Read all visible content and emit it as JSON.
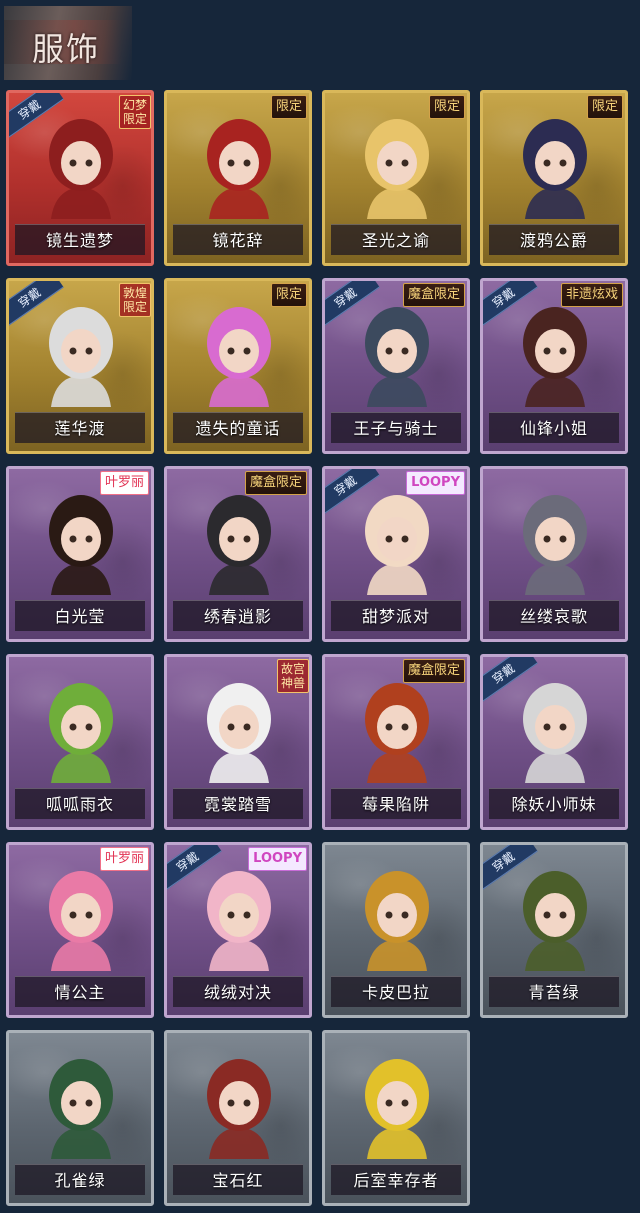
{
  "header": {
    "title": "服饰"
  },
  "badge_wear_label": "穿戴",
  "costumes": [
    {
      "name": "镜生遗梦",
      "rarity": "red",
      "worn": true,
      "tag": "幻梦限定",
      "tag_style": "vertical",
      "accent": "#8d1e1e"
    },
    {
      "name": "镜花辞",
      "rarity": "gold",
      "worn": false,
      "tag": "限定",
      "tag_style": "gold",
      "accent": "#a82320"
    },
    {
      "name": "圣光之谕",
      "rarity": "gold",
      "worn": false,
      "tag": "限定",
      "tag_style": "gold",
      "accent": "#e8c46a"
    },
    {
      "name": "渡鸦公爵",
      "rarity": "gold",
      "worn": false,
      "tag": "限定",
      "tag_style": "gold",
      "accent": "#2c2c52"
    },
    {
      "name": "莲华渡",
      "rarity": "gold",
      "worn": true,
      "tag": "敦煌限定",
      "tag_style": "vertical",
      "accent": "#dcdcdc"
    },
    {
      "name": "遗失的童话",
      "rarity": "gold",
      "worn": false,
      "tag": "限定",
      "tag_style": "gold",
      "accent": "#d86bd0"
    },
    {
      "name": "王子与骑士",
      "rarity": "purple",
      "worn": true,
      "tag": "魔盒限定",
      "tag_style": "gold",
      "accent": "#3c4a5e"
    },
    {
      "name": "仙锋小姐",
      "rarity": "purple",
      "worn": true,
      "tag": "非遗炫戏",
      "tag_style": "gold",
      "accent": "#4a2420"
    },
    {
      "name": "白光莹",
      "rarity": "purple",
      "worn": false,
      "tag": "叶罗丽",
      "tag_style": "pink",
      "accent": "#2a1a14"
    },
    {
      "name": "绣春逍影",
      "rarity": "purple",
      "worn": false,
      "tag": "魔盒限定",
      "tag_style": "gold",
      "accent": "#2b2a2e"
    },
    {
      "name": "甜梦派对",
      "rarity": "purple",
      "worn": true,
      "tag": "LOOPY",
      "tag_style": "loopy",
      "accent": "#f2d9c4"
    },
    {
      "name": "丝缕哀歌",
      "rarity": "purple",
      "worn": false,
      "tag": "",
      "tag_style": "",
      "accent": "#6b6b7a"
    },
    {
      "name": "呱呱雨衣",
      "rarity": "purple",
      "worn": false,
      "tag": "",
      "tag_style": "",
      "accent": "#6fae3a"
    },
    {
      "name": "霓裳踏雪",
      "rarity": "purple",
      "worn": false,
      "tag": "故宫神兽",
      "tag_style": "vertical",
      "accent": "#f0f0f0"
    },
    {
      "name": "莓果陷阱",
      "rarity": "purple",
      "worn": false,
      "tag": "魔盒限定",
      "tag_style": "gold",
      "accent": "#b0401e"
    },
    {
      "name": "除妖小师妹",
      "rarity": "purple",
      "worn": true,
      "tag": "",
      "tag_style": "",
      "accent": "#d6d6d6"
    },
    {
      "name": "情公主",
      "rarity": "purple",
      "worn": false,
      "tag": "叶罗丽",
      "tag_style": "pink",
      "accent": "#e97aa6"
    },
    {
      "name": "绒绒对决",
      "rarity": "purple",
      "worn": true,
      "tag": "LOOPY",
      "tag_style": "loopy",
      "accent": "#f1b5c8"
    },
    {
      "name": "卡皮巴拉",
      "rarity": "gray",
      "worn": false,
      "tag": "",
      "tag_style": "",
      "accent": "#c9922a"
    },
    {
      "name": "青苔绿",
      "rarity": "gray",
      "worn": true,
      "tag": "",
      "tag_style": "",
      "accent": "#4b5e2a"
    },
    {
      "name": "孔雀绿",
      "rarity": "gray",
      "worn": false,
      "tag": "",
      "tag_style": "",
      "accent": "#2e5a3a"
    },
    {
      "name": "宝石红",
      "rarity": "gray",
      "worn": false,
      "tag": "",
      "tag_style": "",
      "accent": "#8a2a24"
    },
    {
      "name": "后室幸存者",
      "rarity": "gray",
      "worn": false,
      "tag": "",
      "tag_style": "",
      "accent": "#e2c12a"
    }
  ]
}
